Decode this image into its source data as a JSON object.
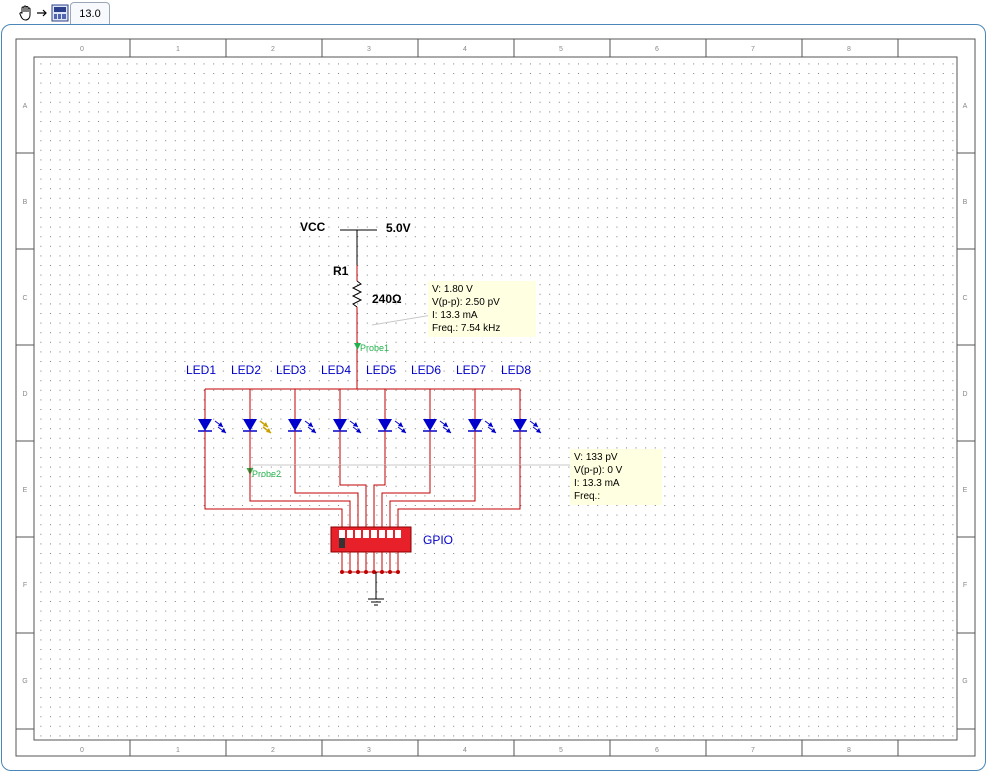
{
  "toolbar": {
    "pan_icon": "hand-pan-icon",
    "arrow_icon": "arrow-right-icon",
    "instrument_icon": "instrument-panel-icon",
    "tab_label": "13.0"
  },
  "ruler": {
    "columns": [
      "0",
      "1",
      "2",
      "3",
      "4",
      "5",
      "6",
      "7",
      "8"
    ],
    "rows": [
      "A",
      "B",
      "C",
      "D",
      "E",
      "F",
      "G"
    ]
  },
  "schematic": {
    "vcc_label": "VCC",
    "vcc_voltage": "5.0V",
    "resistor_ref": "R1",
    "resistor_value": "240Ω",
    "probe1_label": "Probe1",
    "probe2_label": "Probe2",
    "leds": [
      "LED1",
      "LED2",
      "LED3",
      "LED4",
      "LED5",
      "LED6",
      "LED7",
      "LED8"
    ],
    "switch_label": "GPIO",
    "wire_color": "#c00000",
    "led_color": "#0000cc",
    "lit_led_color": "#c8a000",
    "probe_color": "#22b14c"
  },
  "probe1": {
    "v": "V: 1.80 V",
    "vpp": "V(p-p): 2.50 pV",
    "i": "I: 13.3 mA",
    "freq": "Freq.: 7.54 kHz"
  },
  "probe2": {
    "v": "V: 133 pV",
    "vpp": "V(p-p): 0 V",
    "i": "I: 13.3 mA",
    "freq": "Freq.:"
  }
}
